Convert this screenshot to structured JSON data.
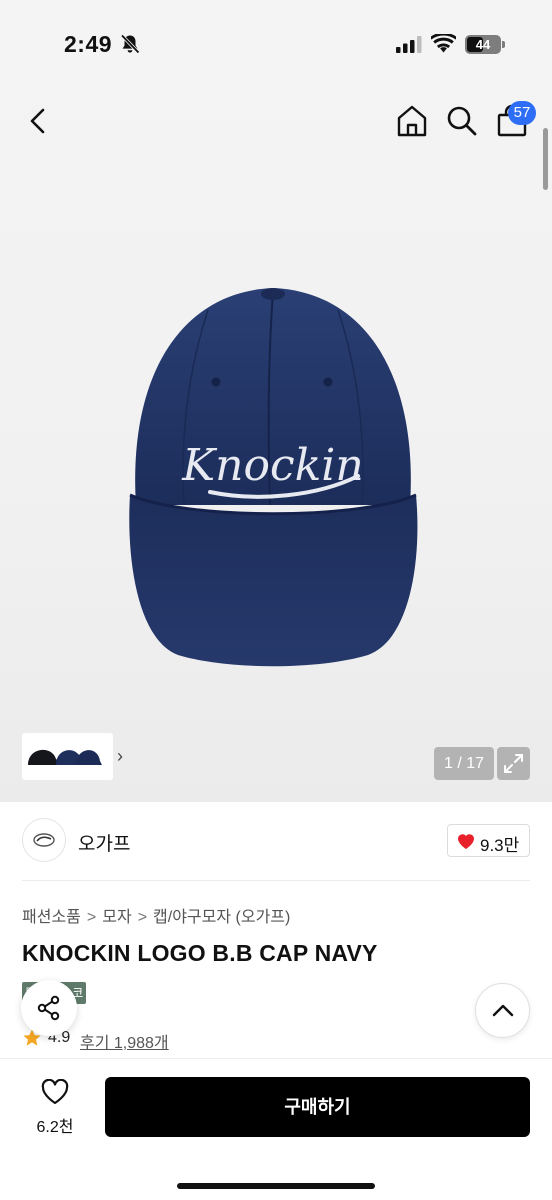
{
  "status_bar": {
    "time": "2:49",
    "battery_level": "44",
    "icons": [
      "bell-slash-icon",
      "cellular-signal-icon",
      "wifi-icon",
      "battery-icon"
    ]
  },
  "top_nav": {
    "icons": [
      "chevron-left-icon",
      "home-icon",
      "search-icon",
      "shopping-bag-icon"
    ],
    "cart_badge": "57"
  },
  "gallery": {
    "counter": "1 / 17",
    "current_index": 1,
    "total": 17,
    "expand_icon": "expand-icon",
    "thumbnail_arrow": "›",
    "product_logo_text": "Knockin",
    "cap_color": "#1f3160"
  },
  "brand": {
    "name": "오가프",
    "like_count": "9.3만",
    "like_color": "#e8202a"
  },
  "breadcrumb": {
    "items": [
      "패션소품",
      "모자",
      "캡/야구모자 (오가프)"
    ],
    "separator": ">"
  },
  "product": {
    "title": "KNOCKIN LOGO B.B CAP NAVY",
    "tag": "무료배송 코",
    "rating": "4.9",
    "reviews": "후기 1,988개",
    "star_color": "#f5a623"
  },
  "bottom_bar": {
    "wish_count": "6.2천",
    "buy_label": "구매하기"
  }
}
